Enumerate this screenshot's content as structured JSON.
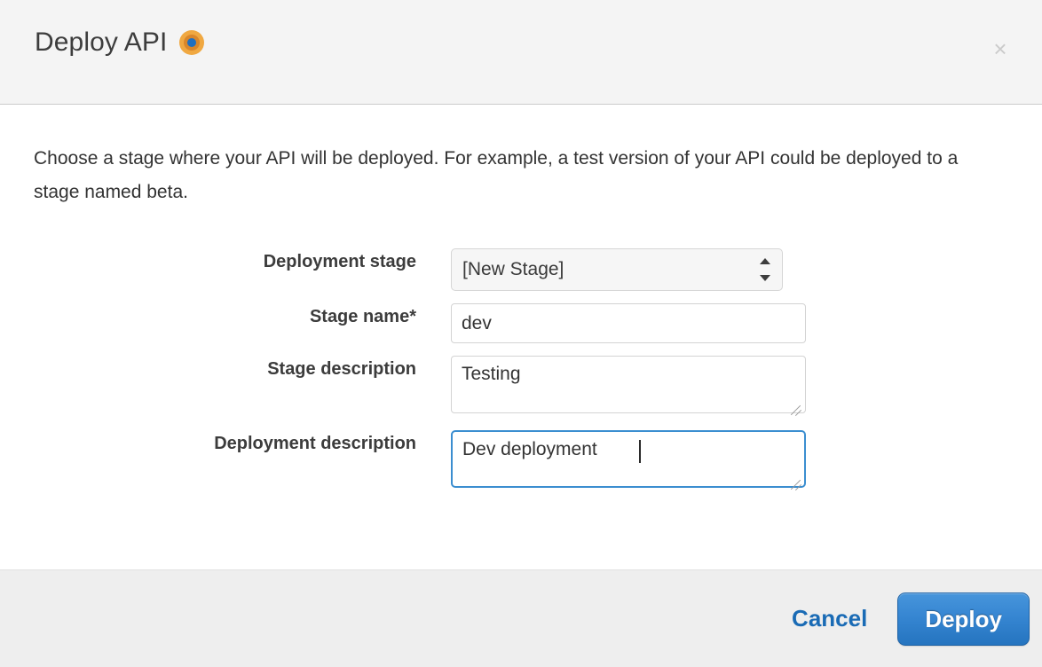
{
  "dialog": {
    "title": "Deploy API",
    "cursor_icon": "cursor-click-indicator-icon",
    "close_label": "×",
    "intro": "Choose a stage where your API will be deployed. For example, a test version of your API could be deployed to a stage named beta."
  },
  "form": {
    "fields": [
      {
        "label": "Deployment stage",
        "type": "select",
        "value": "[New Stage]",
        "options": [
          "[New Stage]"
        ]
      },
      {
        "label": "Stage name*",
        "type": "text",
        "value": "dev",
        "placeholder": ""
      },
      {
        "label": "Stage description",
        "type": "textarea",
        "value": "Testing",
        "placeholder": ""
      },
      {
        "label": "Deployment description",
        "type": "textarea",
        "value": "Dev deployment",
        "placeholder": "",
        "focused": true
      }
    ]
  },
  "footer": {
    "cancel_label": "Cancel",
    "deploy_label": "Deploy"
  },
  "colors": {
    "header_bg": "#f4f4f4",
    "footer_bg": "#eeeeee",
    "link_blue": "#1a6bb5",
    "button_blue": "#3686d2",
    "focus_blue": "#3b8ed0",
    "cursor_orange": "#f0a841",
    "cursor_center_blue": "#1f6fc0",
    "label_text": "#3c3c3c"
  }
}
